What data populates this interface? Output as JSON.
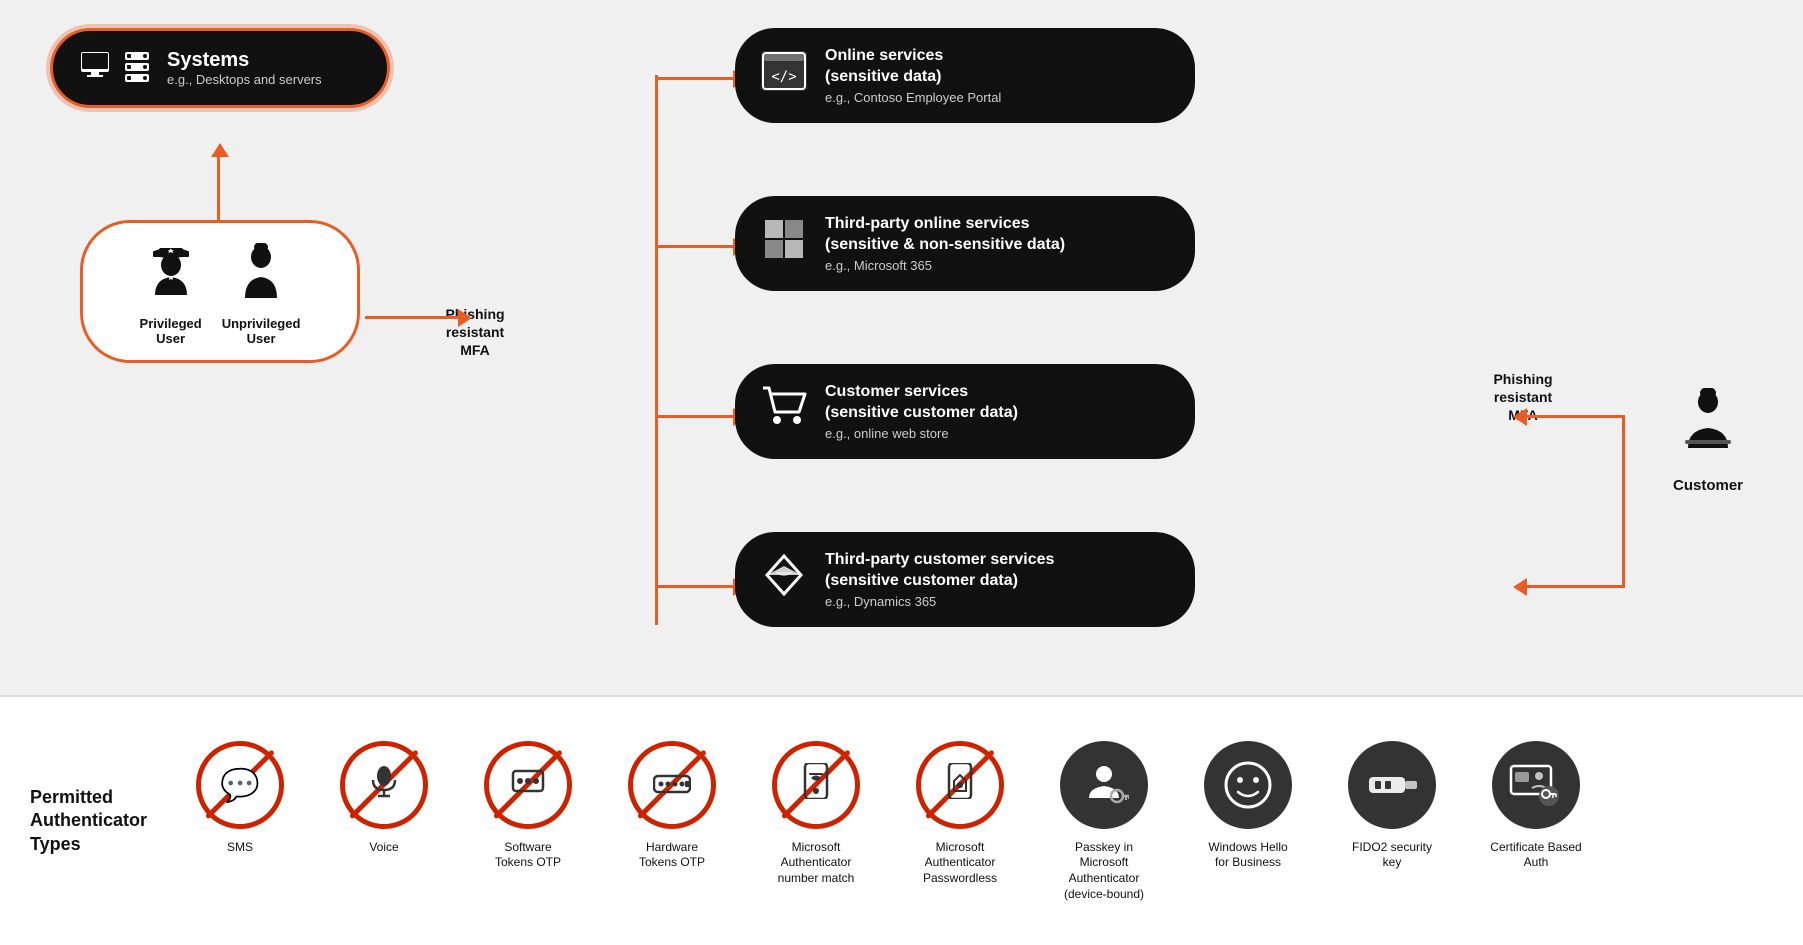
{
  "systems": {
    "title": "Systems",
    "subtitle": "e.g., Desktops and servers"
  },
  "users": {
    "privileged_label": "Privileged\nUser",
    "unprivileged_label": "Unprivileged\nUser"
  },
  "phishing_left": "Phishing\nresistant\nMFA",
  "phishing_right": "Phishing\nresistant\nMFA",
  "services": [
    {
      "title": "Online services\n(sensitive data)",
      "subtitle": "e.g., Contoso Employee Portal"
    },
    {
      "title": "Third-party online services\n(sensitive & non-sensitive data)",
      "subtitle": "e.g., Microsoft 365"
    },
    {
      "title": "Customer services\n(sensitive customer data)",
      "subtitle": "e.g., online web store"
    },
    {
      "title": "Third-party customer services\n(sensitive customer data)",
      "subtitle": "e.g., Dynamics 365"
    }
  ],
  "customer": {
    "label": "Customer"
  },
  "bottom": {
    "permitted_label": "Permitted\nAuthenticator\nTypes",
    "auth_items": [
      {
        "label": "SMS",
        "allowed": false,
        "icon": "💬"
      },
      {
        "label": "Voice",
        "allowed": false,
        "icon": "🎤"
      },
      {
        "label": "Software\nTokens OTP",
        "allowed": false,
        "icon": "⊞"
      },
      {
        "label": "Hardware\nTokens OTP",
        "allowed": false,
        "icon": "⬛"
      },
      {
        "label": "Microsoft\nAuthenticator\nnumber match",
        "allowed": false,
        "icon": "🔓"
      },
      {
        "label": "Microsoft\nAuthenticator\nPasswordless",
        "allowed": false,
        "icon": "🔒"
      },
      {
        "label": "Passkey in\nMicrosoft\nAuthenticator\n(device-bound)",
        "allowed": true,
        "icon": "👤🔑"
      },
      {
        "label": "Windows Hello\nfor Business",
        "allowed": true,
        "icon": "⊙"
      },
      {
        "label": "FIDO2 security\nkey",
        "allowed": true,
        "icon": "🔑"
      },
      {
        "label": "Certificate Based\nAuth",
        "allowed": true,
        "icon": "🪪"
      }
    ]
  }
}
